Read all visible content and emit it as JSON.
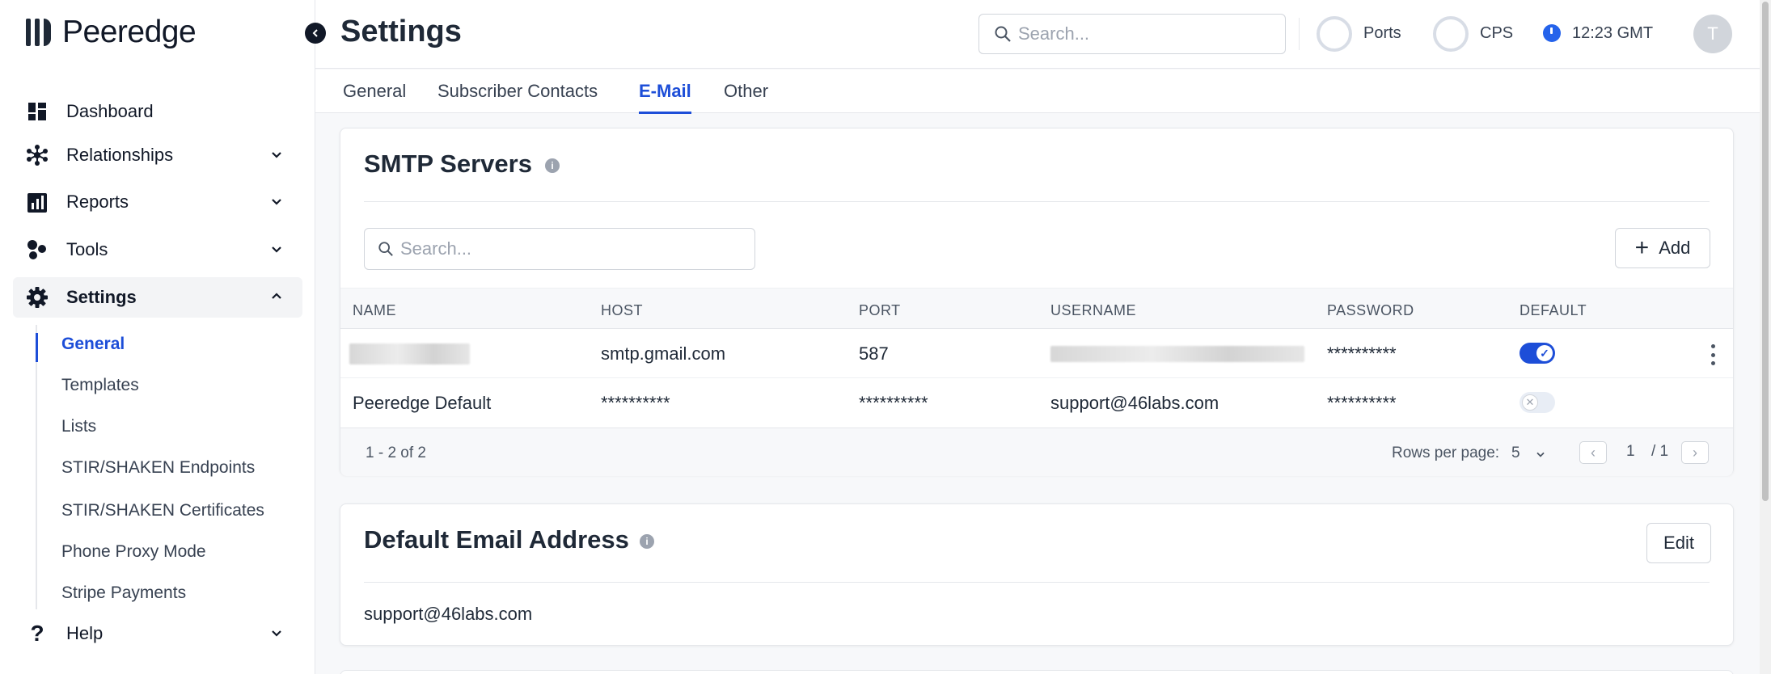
{
  "app": {
    "logo_text": "Peeredge"
  },
  "sidebar": {
    "items": [
      {
        "label": "Dashboard",
        "icon": "dashboard-icon"
      },
      {
        "label": "Relationships",
        "icon": "relationships-icon"
      },
      {
        "label": "Reports",
        "icon": "reports-icon"
      },
      {
        "label": "Tools",
        "icon": "tools-icon"
      },
      {
        "label": "Settings",
        "icon": "gear-icon"
      }
    ],
    "settings_sub": [
      {
        "label": "General",
        "active": true
      },
      {
        "label": "Templates"
      },
      {
        "label": "Lists"
      },
      {
        "label": "STIR/SHAKEN Endpoints"
      },
      {
        "label": "STIR/SHAKEN Certificates"
      },
      {
        "label": "Phone Proxy Mode"
      },
      {
        "label": "Stripe Payments"
      }
    ],
    "help_label": "Help"
  },
  "header": {
    "title": "Settings",
    "search_placeholder": "Search...",
    "ports_label": "Ports",
    "cps_label": "CPS",
    "time": "12:23 GMT",
    "avatar_initial": "T"
  },
  "tabs": [
    "General",
    "Subscriber Contacts",
    "E-Mail",
    "Other"
  ],
  "active_tab": "E-Mail",
  "smtp": {
    "title": "SMTP Servers",
    "search_placeholder": "Search...",
    "add_label": "Add",
    "columns": [
      "NAME",
      "HOST",
      "PORT",
      "USERNAME",
      "PASSWORD",
      "DEFAULT"
    ],
    "rows": [
      {
        "name": "",
        "host": "smtp.gmail.com",
        "port": "587",
        "username": "",
        "password": "**********",
        "default": true
      },
      {
        "name": "Peeredge Default",
        "host": "**********",
        "port": "**********",
        "username": "support@46labs.com",
        "password": "**********",
        "default": false
      }
    ],
    "range_text": "1 - 2 of 2",
    "rows_per_page_label": "Rows per page:",
    "rows_per_page_value": "5",
    "page_current": "1",
    "page_total": "/ 1"
  },
  "default_email": {
    "title": "Default Email Address",
    "edit_label": "Edit",
    "value": "support@46labs.com"
  },
  "colors": {
    "accent": "#1d4ed8",
    "text": "#1f2937",
    "border": "#e5e7eb"
  }
}
